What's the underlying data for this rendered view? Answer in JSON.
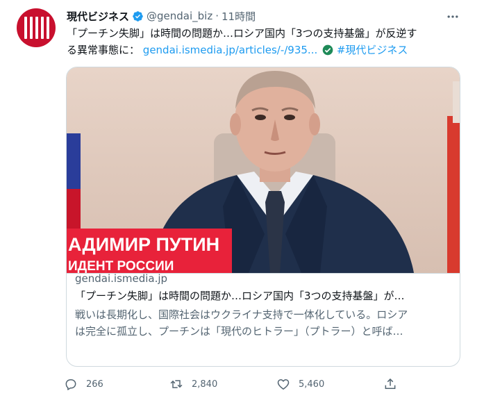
{
  "account": {
    "display_name": "現代ビジネス",
    "handle": "@gendai_biz",
    "separator": "·",
    "time": "11時間"
  },
  "tweet": {
    "line1": "「プーチン失脚」は時間の問題か…ロシア国内「3つの支持基盤」が反逆す",
    "line2_prefix": "る異常事態に：",
    "link": "gendai.ismedia.jp/articles/-/935...",
    "hashtag": "#現代ビジネス"
  },
  "card": {
    "overlay_line1": "АДИМИР ПУТИН",
    "overlay_line2": "ИДЕНТ РОССИИ",
    "domain": "gendai.ismedia.jp",
    "title": "「プーチン失脚」は時間の問題か…ロシア国内「3つの支持基盤」が…",
    "desc_line1": "戦いは長期化し、国際社会はウクライナ支持で一体化している。ロシア",
    "desc_line2": "は完全に孤立し、プーチンは「現代のヒトラー」（プトラー）と呼ば…"
  },
  "actions": {
    "replies": "266",
    "retweets": "2,840",
    "likes": "5,460"
  },
  "colors": {
    "brand_red": "#c8102e",
    "link_blue": "#1d9bf0",
    "verified_blue": "#1d9bf0",
    "hashtag_check_green": "#1e8a58"
  },
  "icons": [
    "verified-badge-icon",
    "more-icon",
    "check-circle-icon",
    "reply-icon",
    "retweet-icon",
    "like-icon",
    "share-icon"
  ]
}
